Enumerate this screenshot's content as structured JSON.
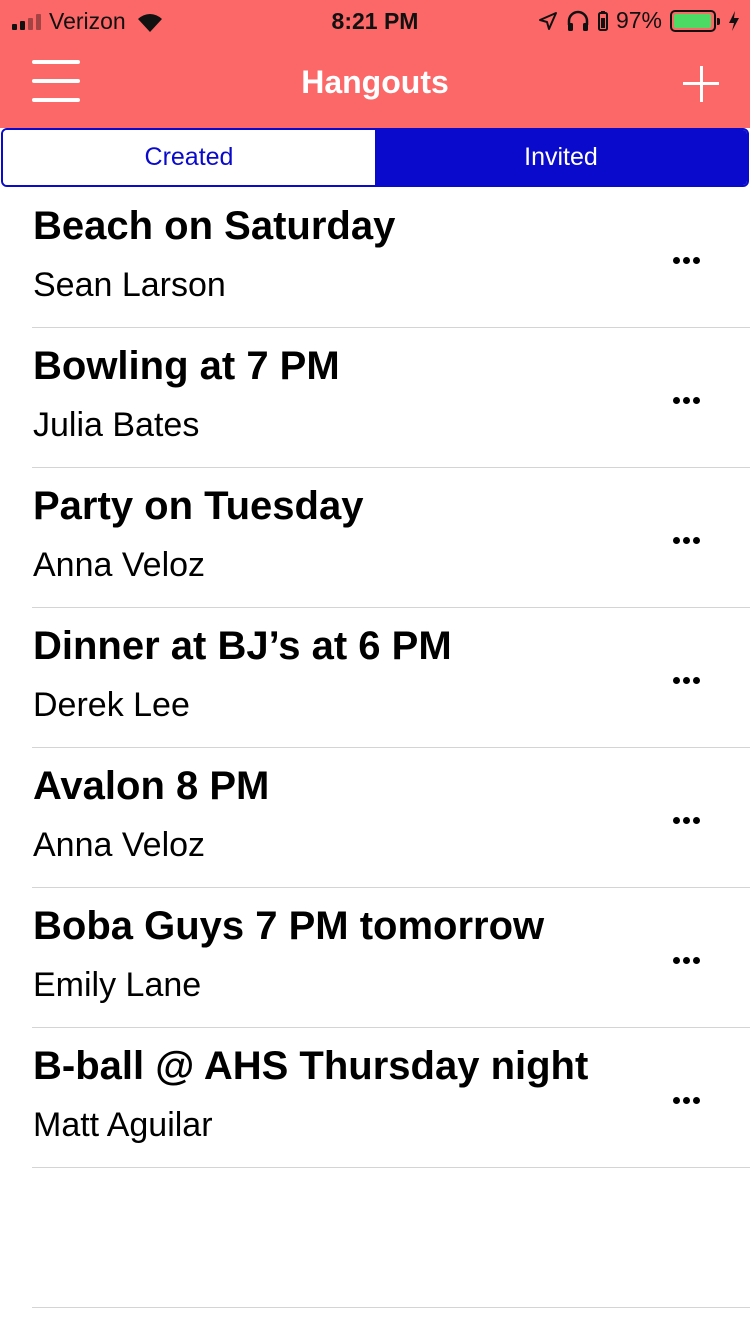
{
  "status_bar": {
    "carrier": "Verizon",
    "time": "8:21 PM",
    "battery_percent": "97%",
    "battery_level": 0.97,
    "icons": [
      "signal-icon",
      "wifi-icon",
      "location-icon",
      "headphones-icon",
      "battery-icon",
      "charging-icon"
    ]
  },
  "nav": {
    "title": "Hangouts",
    "menu_icon": "hamburger-icon",
    "add_icon": "plus-icon"
  },
  "tabs": [
    {
      "label": "Created",
      "selected": false
    },
    {
      "label": "Invited",
      "selected": true
    }
  ],
  "hangouts": [
    {
      "title": "Beach on Saturday",
      "host": "Sean Larson"
    },
    {
      "title": "Bowling at 7 PM",
      "host": "Julia Bates"
    },
    {
      "title": "Party on Tuesday",
      "host": "Anna Veloz"
    },
    {
      "title": "Dinner at BJ’s at 6 PM",
      "host": "Derek Lee"
    },
    {
      "title": "Avalon 8 PM",
      "host": "Anna Veloz"
    },
    {
      "title": "Boba Guys 7 PM tomorrow",
      "host": "Emily Lane"
    },
    {
      "title": "B-ball @ AHS Thursday night",
      "host": "Matt Aguilar"
    }
  ],
  "colors": {
    "header": "#fc6767",
    "tab_accent": "#0a0acc",
    "battery_fill": "#4cd964",
    "divider": "#d4d4d4"
  }
}
